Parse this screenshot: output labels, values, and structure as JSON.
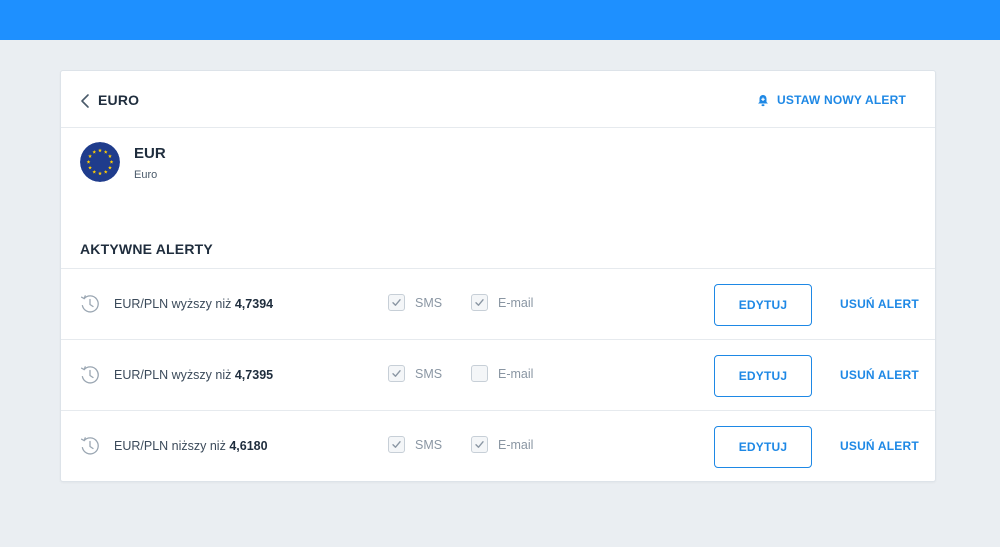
{
  "header": {
    "title": "EURO",
    "new_alert_label": "USTAW NOWY ALERT"
  },
  "currency": {
    "code": "EUR",
    "name": "Euro",
    "flag_icon": "eu-flag-icon"
  },
  "section_title": "AKTYWNE ALERTY",
  "colors": {
    "topbar": "#1e90ff",
    "accent": "#1e88e5",
    "background": "#eaeef2"
  },
  "alerts": [
    {
      "prefix": "EUR/PLN wyższy niż ",
      "value": "4,7394",
      "sms_label": "SMS",
      "sms_checked": true,
      "email_label": "E-mail",
      "email_checked": true,
      "edit_label": "EDYTUJ",
      "delete_label": "USUŃ ALERT"
    },
    {
      "prefix": "EUR/PLN wyższy niż ",
      "value": "4,7395",
      "sms_label": "SMS",
      "sms_checked": true,
      "email_label": "E-mail",
      "email_checked": false,
      "edit_label": "EDYTUJ",
      "delete_label": "USUŃ ALERT"
    },
    {
      "prefix": "EUR/PLN niższy niż ",
      "value": "4,6180",
      "sms_label": "SMS",
      "sms_checked": true,
      "email_label": "E-mail",
      "email_checked": true,
      "edit_label": "EDYTUJ",
      "delete_label": "USUŃ ALERT"
    }
  ]
}
